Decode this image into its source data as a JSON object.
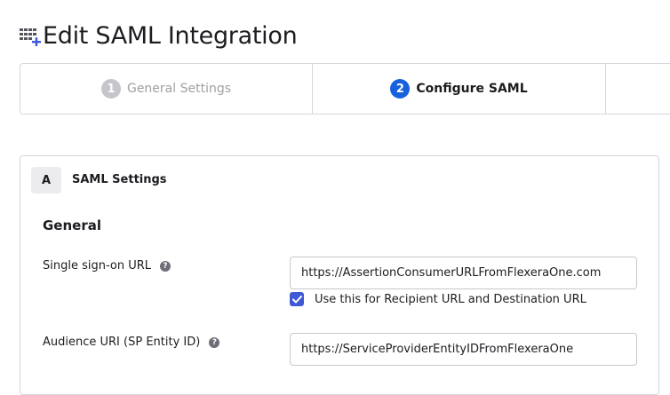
{
  "header": {
    "title": "Edit SAML Integration",
    "icon": "grid-plus-icon"
  },
  "stepper": {
    "steps": [
      {
        "number": "1",
        "label": "General Settings",
        "state": "completed"
      },
      {
        "number": "2",
        "label": "Configure SAML",
        "state": "active"
      }
    ]
  },
  "panel": {
    "badge": "A",
    "title": "SAML Settings",
    "section": "General",
    "fields": {
      "sso_url": {
        "label": "Single sign-on URL",
        "value": "https://AssertionConsumerURLFromFlexeraOne.com"
      },
      "checkbox": {
        "label": "Use this for Recipient URL and Destination URL",
        "checked": true
      },
      "audience_uri": {
        "label": "Audience URI (SP Entity ID)",
        "value": "https://ServiceProviderEntityIDFromFlexeraOne"
      }
    }
  },
  "colors": {
    "accent": "#1662dd",
    "checkbox": "#3e59d3",
    "border": "#d7d7dc",
    "muted": "#a0a0a6"
  }
}
